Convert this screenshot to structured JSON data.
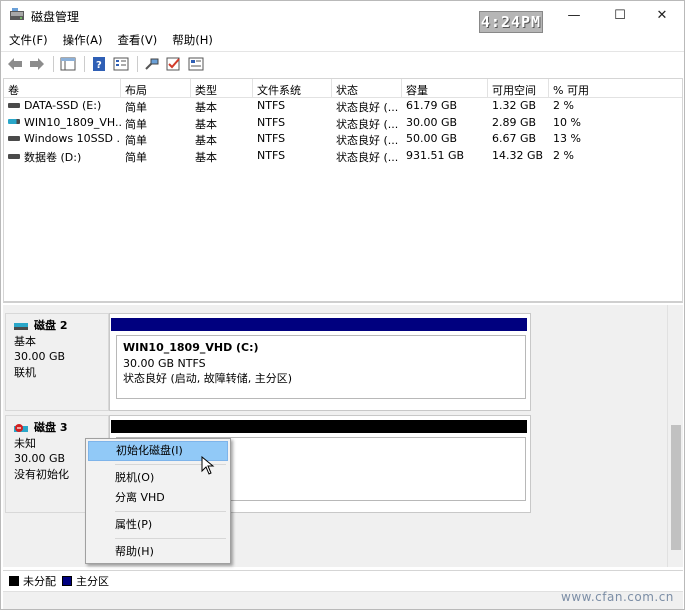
{
  "window": {
    "title": "磁盘管理",
    "clock": "4:24PM",
    "minimize": "—",
    "maximize": "☐",
    "close": "✕"
  },
  "menu": [
    "文件(F)",
    "操作(A)",
    "查看(V)",
    "帮助(H)"
  ],
  "toolbar": [
    "back-arrow-icon",
    "forward-arrow-icon",
    "console-tree-icon",
    "help-icon",
    "properties-icon",
    "connect-icon",
    "check-icon",
    "details-icon"
  ],
  "columns": [
    "卷",
    "布局",
    "类型",
    "文件系统",
    "状态",
    "容量",
    "可用空间",
    "% 可用"
  ],
  "volumes": [
    {
      "icon": "drive-icon",
      "cells": [
        "DATA-SSD (E:)",
        "简单",
        "基本",
        "NTFS",
        "状态良好 (...",
        "61.79 GB",
        "1.32 GB",
        "2 %"
      ]
    },
    {
      "icon": "vhd-drive-icon",
      "cells": [
        "WIN10_1809_VH...",
        "简单",
        "基本",
        "NTFS",
        "状态良好 (...",
        "30.00 GB",
        "2.89 GB",
        "10 %"
      ]
    },
    {
      "icon": "drive-icon",
      "cells": [
        "Windows 10SSD ...",
        "简单",
        "基本",
        "NTFS",
        "状态良好 (...",
        "50.00 GB",
        "6.67 GB",
        "13 %"
      ]
    },
    {
      "icon": "drive-icon",
      "cells": [
        "数据卷 (D:)",
        "简单",
        "基本",
        "NTFS",
        "状态良好 (...",
        "931.51 GB",
        "14.32 GB",
        "2 %"
      ]
    }
  ],
  "disks": [
    {
      "name": "磁盘 2",
      "type": "基本",
      "size": "30.00 GB",
      "status": "联机",
      "partition": {
        "name": "WIN10_1809_VHD  (C:)",
        "size": "30.00 GB NTFS",
        "status": "状态良好 (启动, 故障转储, 主分区)",
        "bar_color": "#00007f"
      }
    },
    {
      "name": "磁盘 3",
      "type": "未知",
      "size": "30.00 GB",
      "status": "没有初始化",
      "partition": {
        "bar_color": "#000000"
      }
    }
  ],
  "legend": [
    {
      "label": "未分配",
      "color": "#000000"
    },
    {
      "label": "主分区",
      "color": "#00007f"
    }
  ],
  "context_menu": {
    "items": [
      "初始化磁盘(I)",
      "脱机(O)",
      "分离 VHD",
      "属性(P)",
      "帮助(H)"
    ]
  },
  "watermark": "www.cfan.com.cn"
}
